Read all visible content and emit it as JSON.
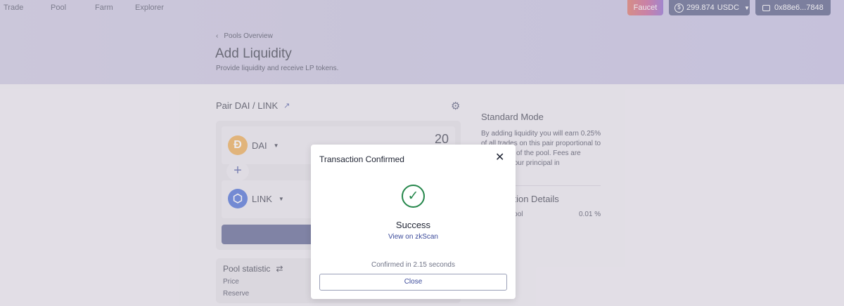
{
  "nav": {
    "links": [
      "Trade",
      "Pool",
      "Farm",
      "Explorer"
    ],
    "faucet_label": "Faucet",
    "balance_amount": "299.874",
    "balance_token": "USDC",
    "wallet_address": "0x88e6...7848"
  },
  "header": {
    "back_label": "Pools Overview",
    "title": "Add Liquidity",
    "subtitle": "Provide liquidity and receive LP tokens."
  },
  "main": {
    "pair_title": "Pair DAI / LINK",
    "token_a": {
      "symbol": "DAI",
      "amount": "20"
    },
    "token_b": {
      "symbol": "LINK"
    },
    "pool_statistic": {
      "title": "Pool statistic",
      "rows": [
        "Price",
        "Reserve"
      ]
    }
  },
  "side": {
    "mode_title": "Standard Mode",
    "mode_text": "By adding liquidity you will earn 0.25% of all trades on this pair proportional to your share of the pool. Fees are added to your principal in",
    "details_title": "Transaction Details",
    "share_label": "Share of pool",
    "share_value": "0.01 %"
  },
  "modal": {
    "title": "Transaction Confirmed",
    "status": "Success",
    "view_link": "View on zkScan",
    "confirmed_text": "Confirmed in 2.15 seconds",
    "close_label": "Close"
  },
  "colors": {
    "primary": "#464e81",
    "success": "#24864a",
    "link": "#3b4a9a"
  }
}
